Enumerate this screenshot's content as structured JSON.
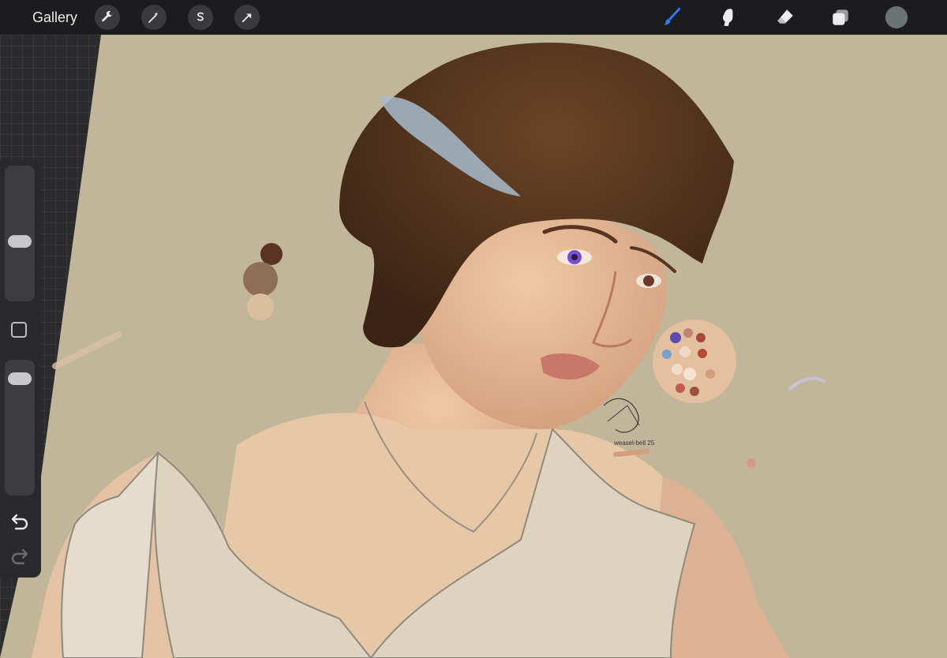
{
  "toolbar": {
    "gallery_label": "Gallery",
    "left_tools": [
      "wrench-icon",
      "magic-wand-icon",
      "selection-s-icon",
      "transform-arrow-icon"
    ],
    "right_tools": [
      "brush-icon",
      "smudge-icon",
      "eraser-icon",
      "layers-icon"
    ],
    "active_tool": "brush",
    "active_color": "#6b7473",
    "brush_accent": "#2f7bff"
  },
  "sidebar": {
    "brush_size_level": 0.45,
    "opacity_level": 0.12,
    "buttons": [
      "modify-square-icon",
      "undo-icon",
      "redo-icon"
    ]
  },
  "canvas": {
    "background_color": "#c2b69a",
    "artwork": "painting of a person with short brown hair and purple eye, wearing a pale tank top",
    "signature_text": "weasel-bell 25"
  }
}
